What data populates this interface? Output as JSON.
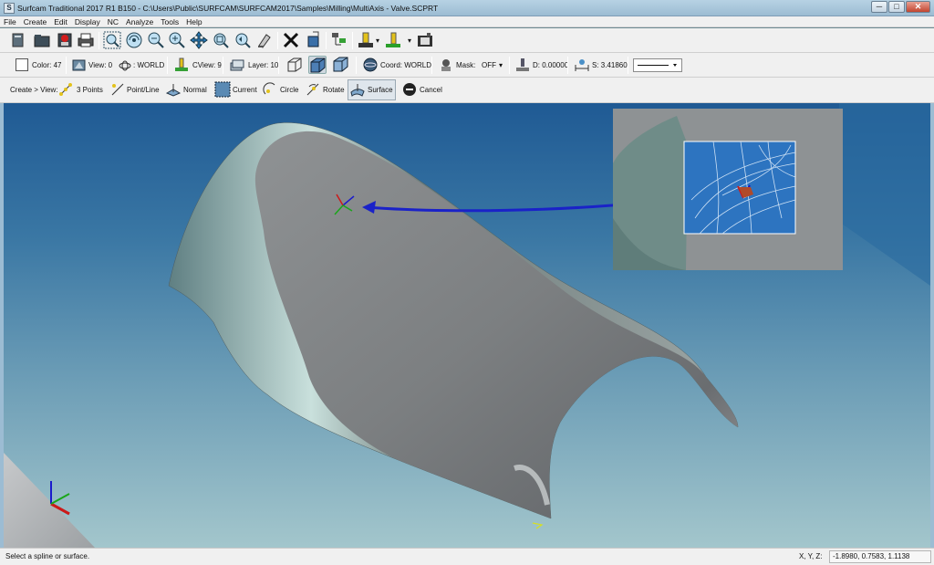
{
  "window": {
    "title": "Surfcam Traditional 2017 R1  B150 - C:\\Users\\Public\\SURFCAM\\SURFCAM2017\\Samples\\Milling\\MultiAxis - Valve.SCPRT",
    "min_label": "─",
    "max_label": "□",
    "close_label": "✕"
  },
  "menu": [
    "File",
    "Create",
    "Edit",
    "Display",
    "NC",
    "Analyze",
    "Tools",
    "Help"
  ],
  "toolbar2": {
    "color": "Color: 47",
    "view": "View: 0",
    "world": ": WORLD",
    "cview": "CView: 9",
    "layer": "Layer: 10",
    "coord": "Coord: WORLD",
    "mask_label": "Mask:",
    "mask_value": "OFF",
    "depth": "D: 0.00000",
    "step": "S: 3.41860"
  },
  "toolbar3": {
    "prefix": "Create > View:",
    "items": [
      "3 Points",
      "Point/Line",
      "Normal",
      "Current",
      "Circle",
      "Rotate",
      "Surface",
      "Cancel"
    ]
  },
  "status": {
    "message": "Select a spline or surface.",
    "xyz_label": "X, Y, Z:",
    "xyz_value": "-1.8980, 0.7583, 1.1138"
  },
  "colors": {
    "accent_arrow": "#1a22c8",
    "surface": "#8a8c8e",
    "viewport_top": "#1f5a94",
    "viewport_bottom": "#a3c6cc"
  },
  "icons": [
    "new-file-icon",
    "open-icon",
    "save-icon",
    "print-icon",
    "zoom-window-icon",
    "zoom-all-icon",
    "zoom-out-icon",
    "zoom-in-icon",
    "pan-icon",
    "zoom-fit-icon",
    "zoom-previous-icon",
    "erase-icon",
    "delete-icon",
    "transform-icon",
    "toolpath-icon",
    "verify-icon",
    "shade-icon",
    "snapshot-icon"
  ]
}
